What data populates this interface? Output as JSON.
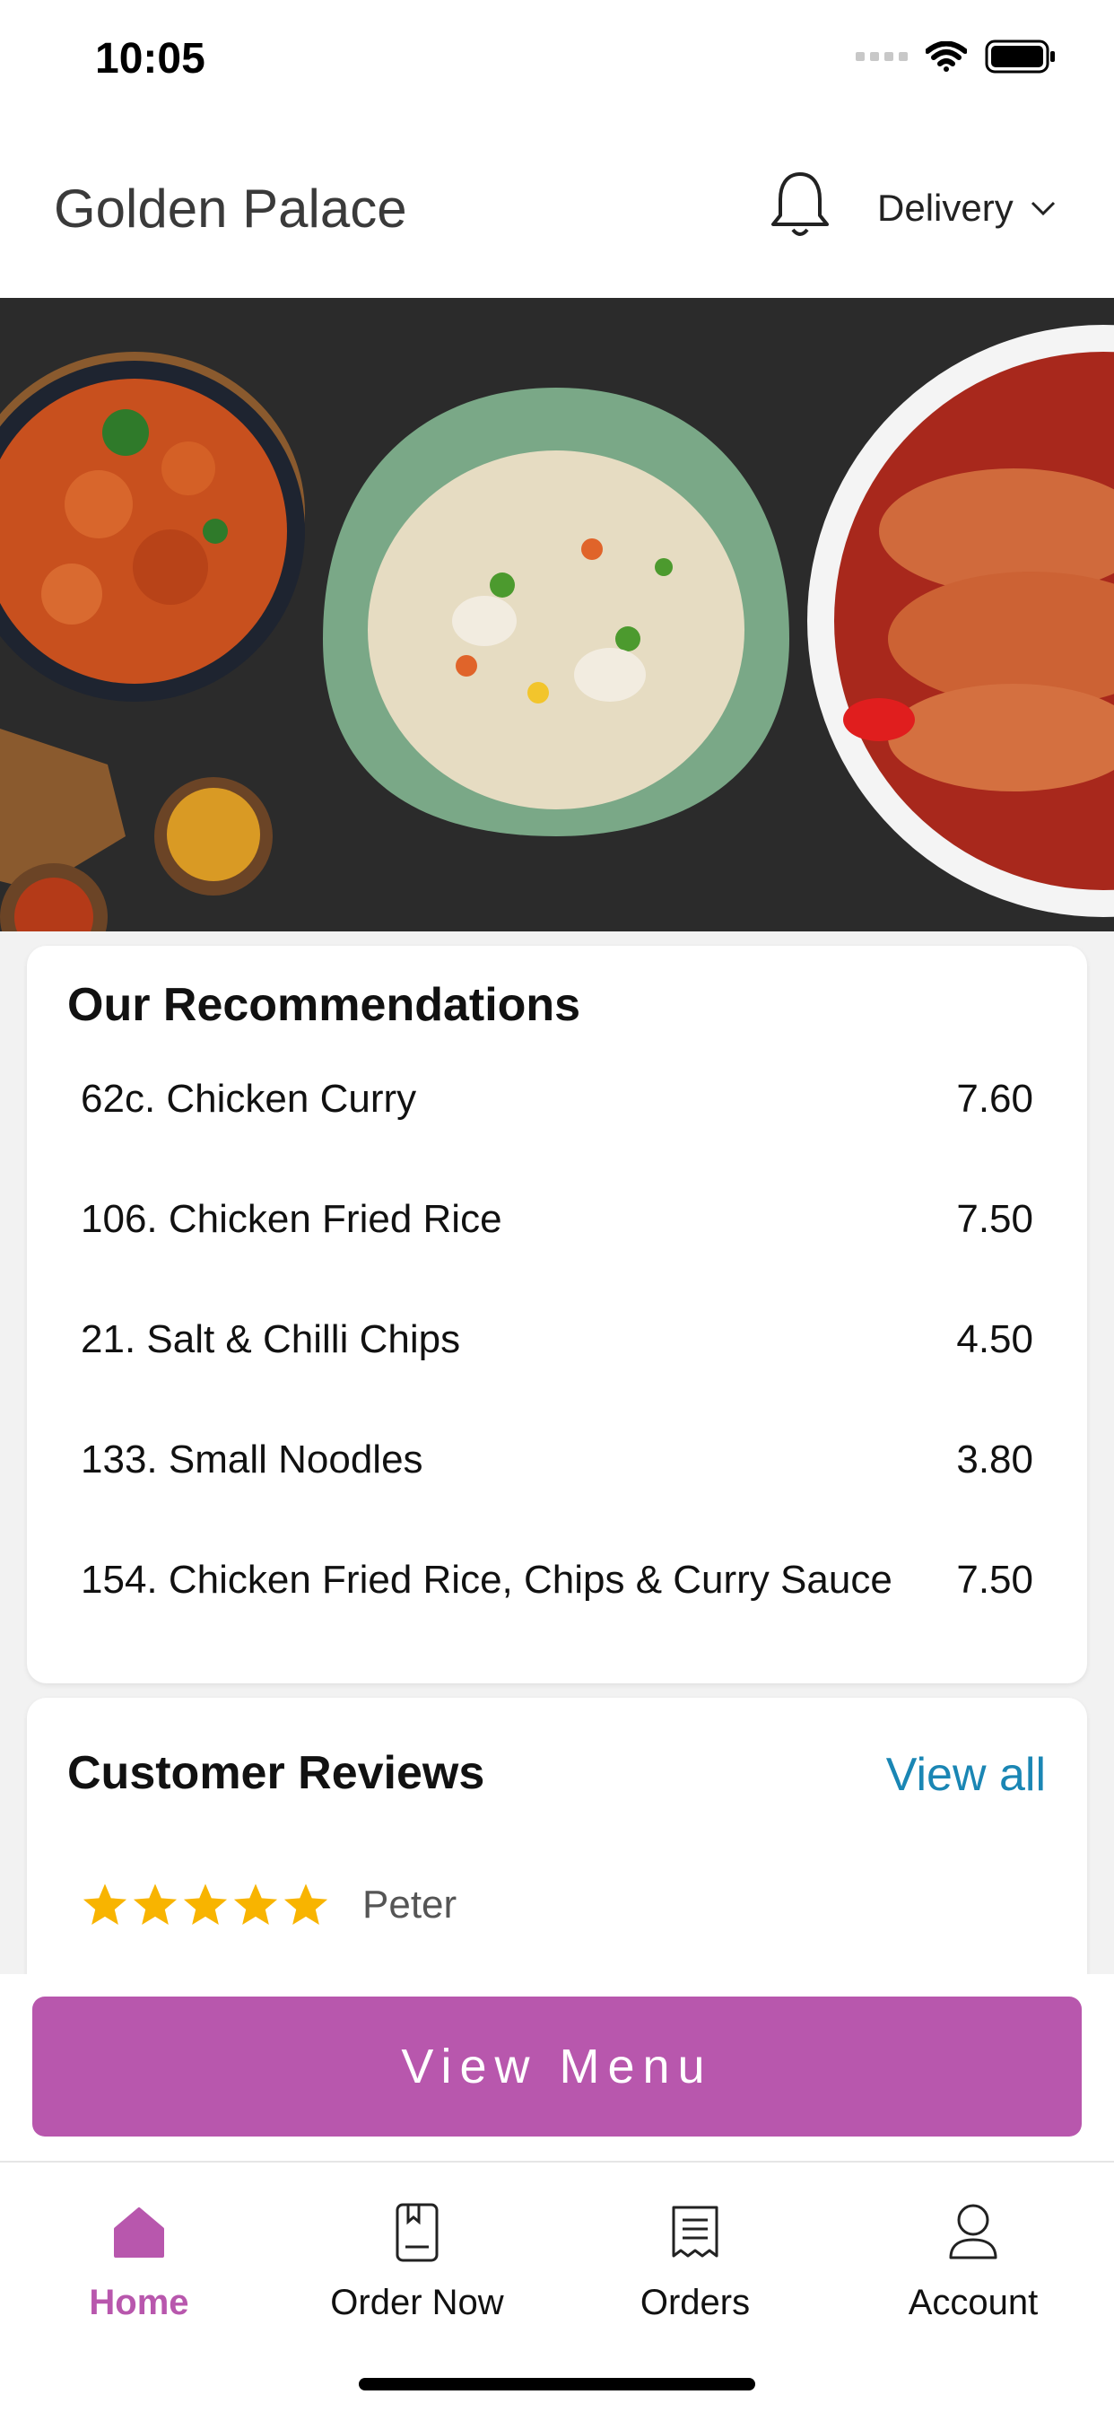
{
  "status_bar": {
    "time": "10:05"
  },
  "header": {
    "title": "Golden Palace",
    "order_mode": "Delivery"
  },
  "recommendations": {
    "title": "Our Recommendations",
    "items": [
      {
        "name": "62c. Chicken Curry",
        "price": "7.60"
      },
      {
        "name": "106. Chicken Fried Rice",
        "price": "7.50"
      },
      {
        "name": "21. Salt & Chilli Chips",
        "price": "4.50"
      },
      {
        "name": "133. Small Noodles",
        "price": "3.80"
      },
      {
        "name": "154. Chicken Fried Rice, Chips & Curry Sauce",
        "price": "7.50"
      }
    ]
  },
  "reviews": {
    "title": "Customer Reviews",
    "view_all_label": "View all",
    "items": [
      {
        "reviewer": "Peter",
        "rating": 5
      }
    ]
  },
  "cta": {
    "label": "View Menu"
  },
  "tabs": [
    {
      "label": "Home",
      "icon": "home-icon",
      "active": true
    },
    {
      "label": "Order Now",
      "icon": "menu-book-icon",
      "active": false
    },
    {
      "label": "Orders",
      "icon": "receipt-icon",
      "active": false
    },
    {
      "label": "Account",
      "icon": "user-icon",
      "active": false
    }
  ],
  "colors": {
    "accent": "#b857ad",
    "link": "#1a86b4",
    "star": "#f8b400"
  }
}
